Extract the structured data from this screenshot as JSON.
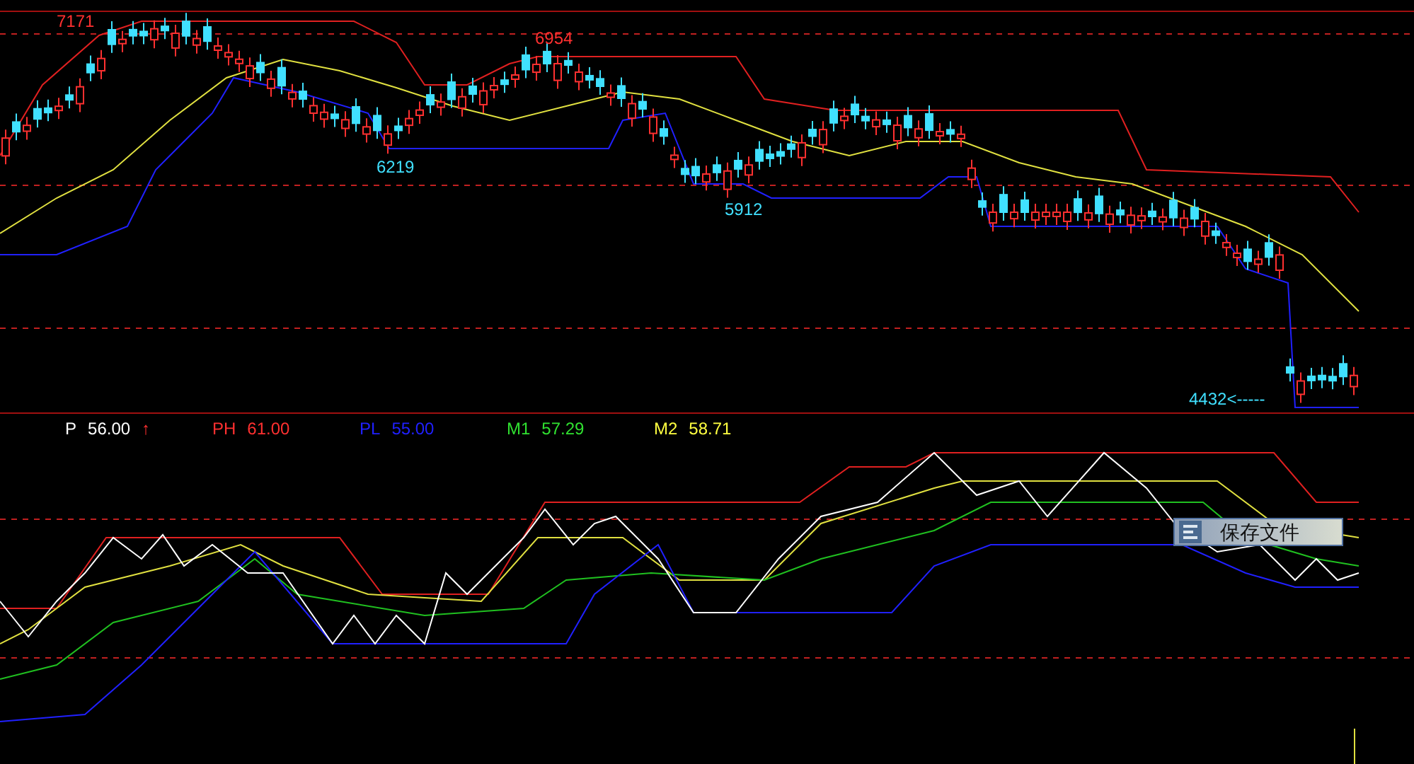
{
  "price_chart": {
    "labels": [
      {
        "text": "7171",
        "kind": "high"
      },
      {
        "text": "6954",
        "kind": "high"
      },
      {
        "text": "6219",
        "kind": "low"
      },
      {
        "text": "5912",
        "kind": "low"
      },
      {
        "text": "4432<-----",
        "kind": "low"
      }
    ]
  },
  "indicator_legend": [
    {
      "name": "P",
      "value": "56.00",
      "arrow": "↑",
      "color": "#ffffff"
    },
    {
      "name": "PH",
      "value": "61.00",
      "color": "#ff3030"
    },
    {
      "name": "PL",
      "value": "55.00",
      "color": "#2020ff"
    },
    {
      "name": "M1",
      "value": "57.29",
      "color": "#30e030"
    },
    {
      "name": "M2",
      "value": "58.71",
      "color": "#ffff40"
    }
  ],
  "tooltip": {
    "text": "保存文件"
  }
}
